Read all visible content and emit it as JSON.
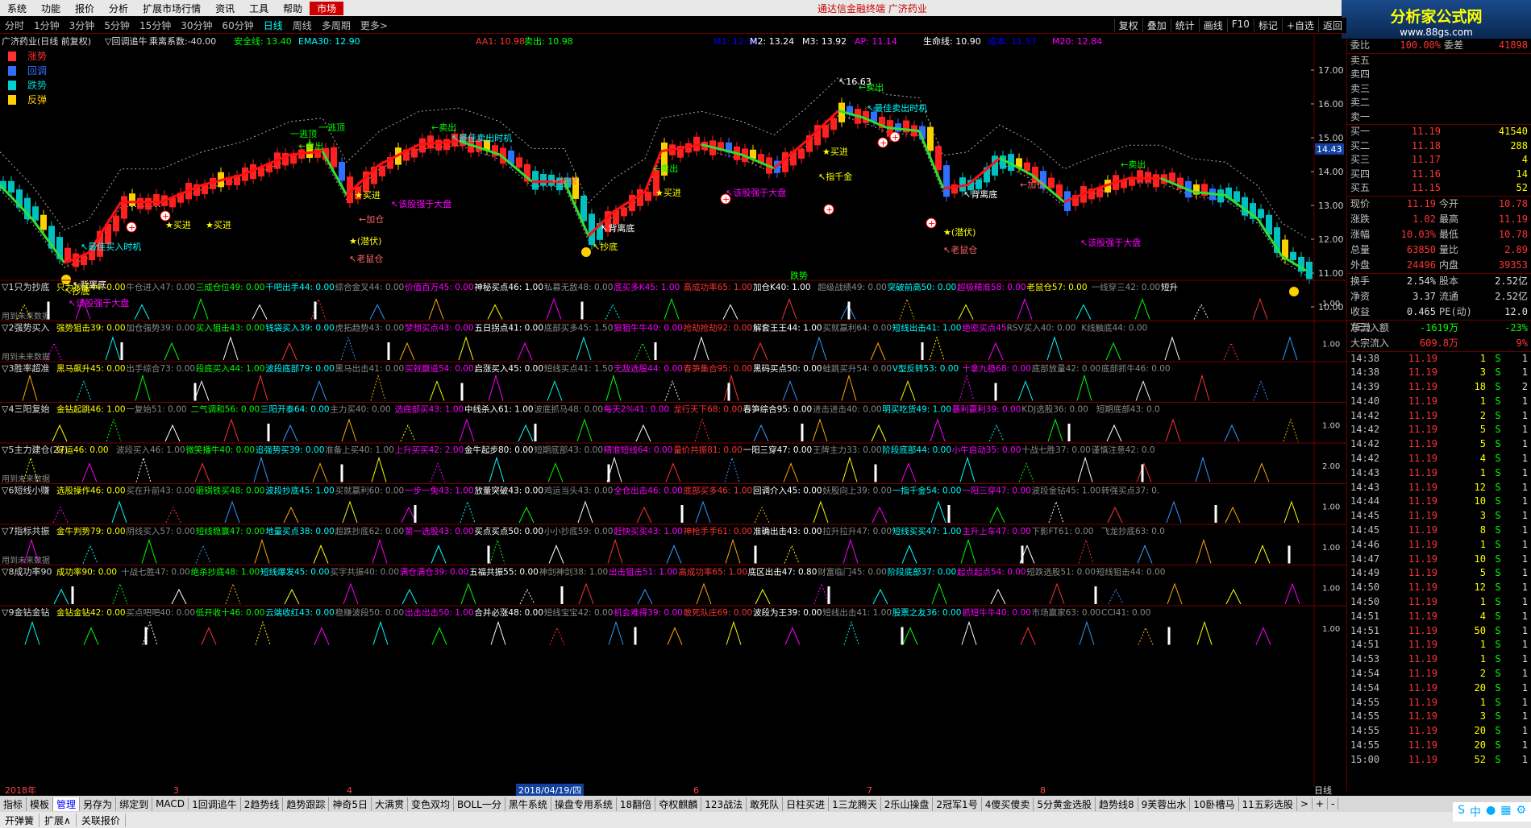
{
  "menu": {
    "items": [
      "系统",
      "功能",
      "报价",
      "分析",
      "扩展市场行情",
      "资讯",
      "工具",
      "帮助"
    ],
    "market": "市场",
    "title": "通达信金融终端 广济药业"
  },
  "logo": {
    "text": "分析家公式网",
    "url": "www.88gs.com"
  },
  "periods": {
    "items": [
      "分时",
      "1分钟",
      "3分钟",
      "5分钟",
      "15分钟",
      "30分钟",
      "60分钟",
      "日线",
      "周线",
      "多周期",
      "更多>"
    ],
    "active": "日线"
  },
  "rtools": [
    "复权",
    "叠加",
    "统计",
    "画线",
    "F10",
    "标记",
    "+自选",
    "返回"
  ],
  "main_header": {
    "stock": "广济药业(日线 前复权)",
    "formula": "▽回调追牛",
    "coef": "乘离系数:-40.00",
    "safe": "安全线: 13.40",
    "ema": "EMA30: 12.90",
    "aa": "AA1: 10.98",
    "sell": "卖出: 10.98",
    "m1": "M1: 12.36",
    "m2": "M2: 13.24",
    "m3": "M3: 13.92",
    "ap": "AP: 11.14",
    "life": "生命线: 10.90",
    "cost": "成本: 11.57",
    "m20": "M20: 12.84"
  },
  "legend": [
    {
      "label": "涨势",
      "color": "#ff3030"
    },
    {
      "label": "回调",
      "color": "#3070ff"
    },
    {
      "label": "跌势",
      "color": "#00d0d0"
    },
    {
      "label": "反弹",
      "color": "#ffd000"
    }
  ],
  "y_ticks": [
    "17.00",
    "16.00",
    "15.00",
    "14.00",
    "13.00",
    "12.00",
    "11.00",
    "10.00"
  ],
  "price_tag": "14.43",
  "bottom_label": "跌势",
  "annotations": [
    {
      "t": "★买进",
      "c": "#ff0",
      "x": 205,
      "y": 283
    },
    {
      "t": "★买进",
      "c": "#ff0",
      "x": 255,
      "y": 283
    },
    {
      "t": "★买进",
      "c": "#ff0",
      "x": 440,
      "y": 246
    },
    {
      "t": "★买进",
      "c": "#ff0",
      "x": 813,
      "y": 243
    },
    {
      "t": "★买进",
      "c": "#ff0",
      "x": 1020,
      "y": 192
    },
    {
      "t": "↖该股强于大盘",
      "c": "#f0f",
      "x": 485,
      "y": 257
    },
    {
      "t": "↖该股强于大盘",
      "c": "#f0f",
      "x": 900,
      "y": 243
    },
    {
      "t": "↖该股强于大盘",
      "c": "#f0f",
      "x": 85,
      "y": 380
    },
    {
      "t": "↖该股强于大盘",
      "c": "#f0f",
      "x": 1340,
      "y": 305
    },
    {
      "t": "★(潜伏)",
      "c": "#ff0",
      "x": 433,
      "y": 303
    },
    {
      "t": "★(潜伏)",
      "c": "#ff0",
      "x": 1170,
      "y": 292
    },
    {
      "t": "↖老鼠仓",
      "c": "#f66",
      "x": 433,
      "y": 325
    },
    {
      "t": "↖老鼠仓",
      "c": "#f66",
      "x": 1170,
      "y": 314
    },
    {
      "t": "↖背离底",
      "c": "#fff",
      "x": 745,
      "y": 287
    },
    {
      "t": "↖背离底",
      "c": "#fff",
      "x": 1195,
      "y": 245
    },
    {
      "t": "↖背离底",
      "c": "#fff",
      "x": 90,
      "y": 357
    },
    {
      "t": "↖最佳卖出时机",
      "c": "#0ff",
      "x": 560,
      "y": 175
    },
    {
      "t": "↖最佳卖出时机",
      "c": "#0ff",
      "x": 1075,
      "y": 138
    },
    {
      "t": "↖最佳买入时机",
      "c": "#0ff",
      "x": 100,
      "y": 310
    },
    {
      "t": "←卖出",
      "c": "#0f0",
      "x": 370,
      "y": 185
    },
    {
      "t": "←卖出",
      "c": "#0f0",
      "x": 535,
      "y": 162
    },
    {
      "t": "←卖出",
      "c": "#0f0",
      "x": 810,
      "y": 213
    },
    {
      "t": "←卖出",
      "c": "#0f0",
      "x": 1065,
      "y": 112
    },
    {
      "t": "←卖出",
      "c": "#0f0",
      "x": 1390,
      "y": 208
    },
    {
      "t": "一逃顶",
      "c": "#0f0",
      "x": 360,
      "y": 170
    },
    {
      "t": "一逃顶",
      "c": "#0f0",
      "x": 395,
      "y": 162
    },
    {
      "t": "↖16.63",
      "c": "#fff",
      "x": 1040,
      "y": 105
    },
    {
      "t": "←加仓",
      "c": "#f66",
      "x": 445,
      "y": 276
    },
    {
      "t": "←加仓",
      "c": "#f66",
      "x": 685,
      "y": 228
    },
    {
      "t": "←加仓",
      "c": "#f66",
      "x": 1265,
      "y": 233
    },
    {
      "t": "↖指千金",
      "c": "#ff0",
      "x": 1015,
      "y": 223
    },
    {
      "t": "↖抄底",
      "c": "#ff0",
      "x": 735,
      "y": 310
    },
    {
      "t": "↖抄底",
      "c": "#ff0",
      "x": 80,
      "y": 365
    }
  ],
  "sub_panels": [
    {
      "idx": "▽1只为抄底",
      "items": [
        [
          "只为抄底44: 0.00",
          "#ff0"
        ],
        [
          "牛仓进入47: 0.00",
          "#888"
        ],
        [
          "三成仓位49: 0.00",
          "#0f0"
        ],
        [
          "千吧出手44: 0.00",
          "#0ff"
        ],
        [
          "综合金叉44: 0.00",
          "#888"
        ],
        [
          "价值百万45: 0.00",
          "#f0f"
        ],
        [
          "神秘买点46: 1.00",
          "#fff"
        ],
        [
          "私募无敌48: 0.00",
          "#888"
        ],
        [
          "底买多K45: 1.00",
          "#f0f"
        ],
        [
          "高成功率65: 1.00",
          "#f33"
        ],
        [
          "加仓K40: 1.00",
          "#fff"
        ],
        [
          "超级战绩49: 0.00",
          "#888"
        ],
        [
          "突破前高50: 0.00",
          "#0ff"
        ],
        [
          "超极精准58: 0.00",
          "#f0f"
        ],
        [
          "老鼠仓57: 0.00",
          "#ff0"
        ],
        [
          "一线穿三42: 0.00",
          "#888"
        ],
        [
          "短升",
          "#fff"
        ]
      ],
      "tick": "1.00",
      "extra": "用到未来数据"
    },
    {
      "idx": "▽2强势买入",
      "items": [
        [
          "强势狙击39: 0.00",
          "#ff0"
        ],
        [
          "加仓强势39: 0.00",
          "#888"
        ],
        [
          "买入狙击43: 0.00",
          "#0f0"
        ],
        [
          "钱袋买入39: 0.00",
          "#0ff"
        ],
        [
          "虎拓趋势43: 0.00",
          "#888"
        ],
        [
          "梦想买点43: 0.00",
          "#f0f"
        ],
        [
          "五日拐点41: 0.00",
          "#fff"
        ],
        [
          "底部买多45: 1.50",
          "#888"
        ],
        [
          "狠狙牛牛40: 0.00",
          "#f0f"
        ],
        [
          "抢劫抢劫92: 0.00",
          "#f33"
        ],
        [
          "解套王王44: 1.00",
          "#fff"
        ],
        [
          "买就赢利64: 0.00",
          "#888"
        ],
        [
          "短线出击41: 1.00",
          "#0ff"
        ],
        [
          "绝密买点45:",
          "#f0f"
        ],
        [
          "RSV买入40: 0.00",
          "#888"
        ],
        [
          "K线触底44: 0.00",
          "#888"
        ]
      ],
      "tick": "1.00",
      "extra": "用到未来数据"
    },
    {
      "idx": "▽3胜率超准",
      "items": [
        [
          "黑马飙升45: 0.00",
          "#ff0"
        ],
        [
          "出手综合73: 0.00",
          "#888"
        ],
        [
          "段底买入44: 1.00",
          "#0f0"
        ],
        [
          "波段底部79: 0.00",
          "#0ff"
        ],
        [
          "黑马出击41: 0.00",
          "#888"
        ],
        [
          "买就赢道54: 0.00",
          "#f0f"
        ],
        [
          "启涨买入45: 0.00",
          "#fff"
        ],
        [
          "短线买点41: 1.50",
          "#888"
        ],
        [
          "无敌选股44: 0.00",
          "#f0f"
        ],
        [
          "春笋集合95: 0.00",
          "#f33"
        ],
        [
          "黑码买点50: 0.00",
          "#fff"
        ],
        [
          "蛙跳买升54: 0.00",
          "#888"
        ],
        [
          "V型反转53: 0.00",
          "#0ff"
        ],
        [
          "十拿九稳68: 0.00",
          "#f0f"
        ],
        [
          "底部放量42: 0.00",
          "#888"
        ],
        [
          "底部抓牛46: 0.00",
          "#888"
        ]
      ],
      "tick": "",
      "extra": ""
    },
    {
      "idx": "▽4三阳复始",
      "items": [
        [
          "金钻起跳46: 1.00",
          "#ff0"
        ],
        [
          "一复始51: 0.00",
          "#888"
        ],
        [
          "二气调和56: 0.00",
          "#0f0"
        ],
        [
          "三阳开泰64: 0.00",
          "#0ff"
        ],
        [
          "主力买40: 0.00",
          "#888"
        ],
        [
          "选底部买43: 1.00",
          "#f0f"
        ],
        [
          "中线杀入61: 1.00",
          "#fff"
        ],
        [
          "波底抓马48: 0.00",
          "#888"
        ],
        [
          "每天2%41: 0.00",
          "#f0f"
        ],
        [
          "龙行天下68: 0.00",
          "#f33"
        ],
        [
          "春笋综合95: 0.00",
          "#fff"
        ],
        [
          "进击进击40: 0.00",
          "#888"
        ],
        [
          "明买吃货49: 1.00",
          "#0ff"
        ],
        [
          "暴利赢利39: 0.00",
          "#f0f"
        ],
        [
          "KDJ选股36: 0.00",
          "#888"
        ],
        [
          "短期底部43: 0.0",
          "#888"
        ]
      ],
      "tick": "1.00",
      "extra": ""
    },
    {
      "idx": "▽5主力建仓(27)",
      "items": [
        [
          "好运46: 0.00",
          "#ff0"
        ],
        [
          "波段买入46: 1.00",
          "#888"
        ],
        [
          "微笑播牛40: 0.00",
          "#0f0"
        ],
        [
          "追强势买39: 0.00",
          "#0ff"
        ],
        [
          "准备上买40: 1.00",
          "#888"
        ],
        [
          "上升买买42: 2.00",
          "#f0f"
        ],
        [
          "金牛起步80: 0.00",
          "#fff"
        ],
        [
          "短期底部43: 0.00",
          "#888"
        ],
        [
          "精准短线64: 0.00",
          "#f0f"
        ],
        [
          "量价共振81: 0.00",
          "#f33"
        ],
        [
          "一阳三穿47: 0.00",
          "#fff"
        ],
        [
          "王牌主力33: 0.00",
          "#888"
        ],
        [
          "阶段底部44: 0.00",
          "#0ff"
        ],
        [
          "小牛启动35: 0.00",
          "#f0f"
        ],
        [
          "十战七胜37: 0.00",
          "#888"
        ],
        [
          "谨慎注意42: 0.0",
          "#888"
        ]
      ],
      "tick": "2.00",
      "extra": "用到未来数据"
    },
    {
      "idx": "▽6短线小赚",
      "items": [
        [
          "选股操作46: 0.00",
          "#ff0"
        ],
        [
          "买在升前43: 0.00",
          "#888"
        ],
        [
          "砸锅铁买48: 0.00",
          "#0f0"
        ],
        [
          "波段抄底45: 1.00",
          "#0ff"
        ],
        [
          "买就赢利60: 0.00",
          "#888"
        ],
        [
          "一步一兔43: 1.00",
          "#f0f"
        ],
        [
          "放量突破43: 0.00",
          "#fff"
        ],
        [
          "鸡运当头43: 0.00",
          "#888"
        ],
        [
          "全仓出击46: 0.00",
          "#f0f"
        ],
        [
          "底部买多46: 1.00",
          "#f33"
        ],
        [
          "回调介入45: 0.00",
          "#fff"
        ],
        [
          "妖股向上39: 0.00",
          "#888"
        ],
        [
          "一指千金54: 0.00",
          "#0ff"
        ],
        [
          "一阳三穿47: 0.00",
          "#f0f"
        ],
        [
          "波段金钻45: 1.00",
          "#888"
        ],
        [
          "转强买点37: 0.",
          "#888"
        ]
      ],
      "tick": "1.00",
      "extra": ""
    },
    {
      "idx": "▽7指标共振",
      "items": [
        [
          "金牛判势79: 0.00",
          "#ff0"
        ],
        [
          "阴线买入57: 0.00",
          "#888"
        ],
        [
          "短线稳赢47: 0.00",
          "#0f0"
        ],
        [
          "地量买点38: 0.00",
          "#0ff"
        ],
        [
          "超跌抄底62: 0.00",
          "#888"
        ],
        [
          "第一选股43: 0.00",
          "#f0f"
        ],
        [
          "买点买点50: 0.00",
          "#fff"
        ],
        [
          "小小抄底59: 0.00",
          "#888"
        ],
        [
          "赶快买买43: 1.00",
          "#f0f"
        ],
        [
          "神枪手手61: 0.00",
          "#f33"
        ],
        [
          "准确出击43: 0.00",
          "#fff"
        ],
        [
          "拉升拉升47: 0.00",
          "#888"
        ],
        [
          "短线买买47: 1.00",
          "#0ff"
        ],
        [
          "主升上车47: 0.00",
          "#f0f"
        ],
        [
          "下影FT61: 0.00",
          "#888"
        ],
        [
          "飞龙抄底63: 0.0",
          "#888"
        ]
      ],
      "tick": "1.00",
      "extra": "用到未来数据"
    },
    {
      "idx": "▽8成功率90",
      "items": [
        [
          "成功率90: 0.00",
          "#ff0"
        ],
        [
          "十战七胜47: 0.00",
          "#888"
        ],
        [
          "绝杀抄底48: 1.00",
          "#0f0"
        ],
        [
          "短线爆发45: 0.00",
          "#0ff"
        ],
        [
          "买字共振40: 0.00",
          "#888"
        ],
        [
          "满仓满仓39: 0.00",
          "#f0f"
        ],
        [
          "五福共振55: 0.00",
          "#fff"
        ],
        [
          "神剑神剑38: 1.00",
          "#888"
        ],
        [
          "出击狙击51: 1.00",
          "#f0f"
        ],
        [
          "高成功率65: 1.00",
          "#f33"
        ],
        [
          "底区出击47: 0.80",
          "#fff"
        ],
        [
          "财富临门45: 0.00",
          "#888"
        ],
        [
          "阶段底部37: 0.00",
          "#0ff"
        ],
        [
          "起点起点54: 0.00",
          "#f0f"
        ],
        [
          "短跌选股51: 0.00",
          "#888"
        ],
        [
          "短线狙击44: 0.00",
          "#888"
        ]
      ],
      "tick": "1.00",
      "extra": ""
    },
    {
      "idx": "▽9金钻金钻",
      "items": [
        [
          "金钻金钻42: 0.00",
          "#ff0"
        ],
        [
          "买点吧吧40: 0.00",
          "#888"
        ],
        [
          "低开收十46: 0.00",
          "#0f0"
        ],
        [
          "云端收红43: 0.00",
          "#0ff"
        ],
        [
          "稳赚波段50: 0.00",
          "#888"
        ],
        [
          "出击出击50: 1.00",
          "#f0f"
        ],
        [
          "合并必涨48: 0.00",
          "#fff"
        ],
        [
          "短线宝宝42: 0.00",
          "#888"
        ],
        [
          "机会难得39: 0.00",
          "#f0f"
        ],
        [
          "敢死队庄69: 0.00",
          "#f33"
        ],
        [
          "波段为王39: 0.00",
          "#fff"
        ],
        [
          "短线出击41: 1.00",
          "#888"
        ],
        [
          "股票之友36: 0.00",
          "#0ff"
        ],
        [
          "抓短牛牛40: 0.00",
          "#f0f"
        ],
        [
          "市场赢家63: 0.00",
          "#888"
        ],
        [
          "CCI41: 0.00",
          "#888"
        ]
      ],
      "tick": "1.00",
      "extra": ""
    }
  ],
  "date_axis": {
    "year": "2018年",
    "marks": [
      "3",
      "4",
      "5",
      "6",
      "7",
      "8"
    ],
    "cursor": "2018/04/19/四",
    "period": "日线"
  },
  "quote": {
    "weibi": {
      "label": "委比",
      "v1": "100.00%",
      "label2": "委差",
      "v2": "41898"
    },
    "sells": [
      [
        "卖五",
        "",
        ""
      ],
      [
        "卖四",
        "",
        ""
      ],
      [
        "卖三",
        "",
        ""
      ],
      [
        "卖二",
        "",
        ""
      ],
      [
        "卖一",
        "",
        ""
      ]
    ],
    "buys": [
      [
        "买一",
        "11.19",
        "41540"
      ],
      [
        "买二",
        "11.18",
        "288"
      ],
      [
        "买三",
        "11.17",
        "4"
      ],
      [
        "买四",
        "11.16",
        "14"
      ],
      [
        "买五",
        "11.15",
        "52"
      ]
    ],
    "info": [
      [
        "现价",
        "11.19",
        "今开",
        "10.78"
      ],
      [
        "涨跌",
        "1.02",
        "最高",
        "11.19"
      ],
      [
        "涨幅",
        "10.03%",
        "最低",
        "10.78"
      ],
      [
        "总量",
        "63850",
        "量比",
        "2.89"
      ],
      [
        "外盘",
        "24496",
        "内盘",
        "39353"
      ]
    ],
    "info2": [
      [
        "换手",
        "2.54%",
        "股本",
        "2.52亿"
      ],
      [
        "净资",
        "3.37",
        "流通",
        "2.52亿"
      ],
      [
        "收益(三)",
        "0.465",
        "PE(动)",
        "12.0"
      ]
    ],
    "flow": [
      [
        "净流入额",
        "-1619万",
        "-23%"
      ],
      [
        "大宗流入",
        "609.8万",
        "9%"
      ]
    ],
    "ticks": [
      [
        "14:38",
        "11.19",
        "1",
        "S",
        "1"
      ],
      [
        "14:38",
        "11.19",
        "3",
        "S",
        "1"
      ],
      [
        "14:39",
        "11.19",
        "18",
        "S",
        "2"
      ],
      [
        "14:40",
        "11.19",
        "1",
        "S",
        "1"
      ],
      [
        "14:42",
        "11.19",
        "2",
        "S",
        "1"
      ],
      [
        "14:42",
        "11.19",
        "5",
        "S",
        "1"
      ],
      [
        "14:42",
        "11.19",
        "5",
        "S",
        "1"
      ],
      [
        "14:42",
        "11.19",
        "4",
        "S",
        "1"
      ],
      [
        "14:43",
        "11.19",
        "1",
        "S",
        "1"
      ],
      [
        "14:43",
        "11.19",
        "12",
        "S",
        "1"
      ],
      [
        "14:44",
        "11.19",
        "10",
        "S",
        "1"
      ],
      [
        "14:45",
        "11.19",
        "3",
        "S",
        "1"
      ],
      [
        "14:45",
        "11.19",
        "8",
        "S",
        "1"
      ],
      [
        "14:46",
        "11.19",
        "1",
        "S",
        "1"
      ],
      [
        "14:47",
        "11.19",
        "10",
        "S",
        "1"
      ],
      [
        "14:49",
        "11.19",
        "5",
        "S",
        "1"
      ],
      [
        "14:50",
        "11.19",
        "12",
        "S",
        "1"
      ],
      [
        "14:50",
        "11.19",
        "1",
        "S",
        "1"
      ],
      [
        "14:51",
        "11.19",
        "4",
        "S",
        "1"
      ],
      [
        "14:51",
        "11.19",
        "50",
        "S",
        "1"
      ],
      [
        "14:51",
        "11.19",
        "1",
        "S",
        "1"
      ],
      [
        "14:53",
        "11.19",
        "1",
        "S",
        "1"
      ],
      [
        "14:54",
        "11.19",
        "2",
        "S",
        "1"
      ],
      [
        "14:54",
        "11.19",
        "20",
        "S",
        "1"
      ],
      [
        "14:55",
        "11.19",
        "1",
        "S",
        "1"
      ],
      [
        "14:55",
        "11.19",
        "3",
        "S",
        "1"
      ],
      [
        "14:55",
        "11.19",
        "20",
        "S",
        "1"
      ],
      [
        "14:55",
        "11.19",
        "20",
        "S",
        "1"
      ],
      [
        "15:00",
        "11.19",
        "52",
        "S",
        "1"
      ]
    ]
  },
  "bottom_tabs": [
    "指标",
    "模板",
    "管理",
    "另存为",
    "绑定到",
    "MACD",
    "1回调追牛",
    "2趋势线",
    "趋势跟踪",
    "神奇5日",
    "大满贯",
    "变色双均",
    "BOLL一分",
    "黑牛系统",
    "操盘专用系统",
    "18翻倍",
    "夺权麒麟",
    "123战法",
    "敢死队",
    "日柱买进",
    "1三龙腾天",
    "2乐山操盘",
    "2冠军1号",
    "4傻买傻卖",
    "5分黄金选股",
    "趋势线8",
    "9芙蓉出水",
    "10卧槽马",
    "11五彩选股",
    ">",
    "+",
    "-"
  ],
  "bottom_active": "管理",
  "status": [
    "开弹簧",
    "扩展∧",
    "关联报价"
  ]
}
